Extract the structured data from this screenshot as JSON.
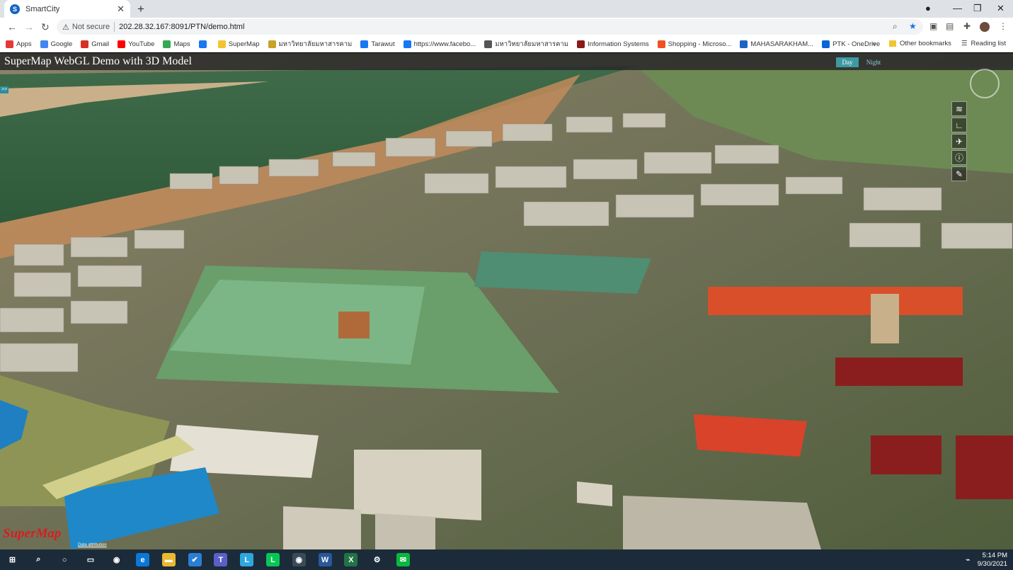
{
  "browser": {
    "tab_title": "SmartCity",
    "tab_close": "✕",
    "new_tab": "+",
    "security_label": "Not secure",
    "url": "202.28.32.167:8091/PTN/demo.html",
    "bookmarks": [
      {
        "label": "Apps",
        "icon": "apps-grid-icon",
        "color": "#e53935"
      },
      {
        "label": "Google",
        "icon": "google-icon",
        "color": "#4285f4"
      },
      {
        "label": "Gmail",
        "icon": "gmail-icon",
        "color": "#d93025"
      },
      {
        "label": "YouTube",
        "icon": "youtube-icon",
        "color": "#ff0000"
      },
      {
        "label": "Maps",
        "icon": "maps-icon",
        "color": "#34a853"
      },
      {
        "label": "",
        "icon": "facebook-icon",
        "color": "#1877f2"
      },
      {
        "label": "SuperMap",
        "icon": "folder-icon",
        "color": "#f4c430"
      },
      {
        "label": "มหาวิทยาลัยมหาสารคาม",
        "icon": "university-icon",
        "color": "#c9a227"
      },
      {
        "label": "Tarawut",
        "icon": "facebook-icon",
        "color": "#1877f2"
      },
      {
        "label": "https://www.facebo...",
        "icon": "facebook-icon",
        "color": "#1877f2"
      },
      {
        "label": "มหาวิทยาลัยมหาสารคาม",
        "icon": "globe-icon",
        "color": "#555555"
      },
      {
        "label": "Information Systems",
        "icon": "emblem-icon",
        "color": "#8b1a1a"
      },
      {
        "label": "Shopping - Microso...",
        "icon": "microsoft-icon",
        "color": "#f25022"
      },
      {
        "label": "MAHASARAKHAM...",
        "icon": "calendar-icon",
        "color": "#1e63c4"
      },
      {
        "label": "PTK - OneDrive",
        "icon": "onedrive-icon",
        "color": "#0a64d8"
      }
    ],
    "more_bookmarks": "»",
    "other_bookmarks": "Other bookmarks",
    "reading_list": "Reading list"
  },
  "app": {
    "title": "SuperMap WebGL Demo with 3D Model",
    "day_label": "Day",
    "night_label": "Night",
    "expander_label": ">>",
    "tools": [
      {
        "name": "layers-icon",
        "glyph": "≋"
      },
      {
        "name": "measure-icon",
        "glyph": "∟"
      },
      {
        "name": "flight-icon",
        "glyph": "✈"
      },
      {
        "name": "info-icon",
        "glyph": "ⓘ"
      },
      {
        "name": "draw-icon",
        "glyph": "✎"
      }
    ],
    "logo_text": "SuperMap",
    "attribution": "Data attribution"
  },
  "taskbar": {
    "apps": [
      {
        "name": "windows-start-icon",
        "glyph": "⊞",
        "color": "#1c2b39"
      },
      {
        "name": "search-icon",
        "glyph": "⌕",
        "color": "#1c2b39"
      },
      {
        "name": "cortana-icon",
        "glyph": "○",
        "color": "#1c2b39"
      },
      {
        "name": "task-view-icon",
        "glyph": "▭",
        "color": "#1c2b39"
      },
      {
        "name": "chrome-icon",
        "glyph": "◉",
        "color": "#1c2b39"
      },
      {
        "name": "edge-icon",
        "glyph": "e",
        "color": "#0b78d7"
      },
      {
        "name": "file-explorer-icon",
        "glyph": "▬",
        "color": "#e9b931"
      },
      {
        "name": "todo-icon",
        "glyph": "✔",
        "color": "#2a7fd4"
      },
      {
        "name": "teams-icon",
        "glyph": "T",
        "color": "#5b5fc7"
      },
      {
        "name": "l-app-icon",
        "glyph": "L",
        "color": "#2ea7e0"
      },
      {
        "name": "line-icon",
        "glyph": "L",
        "color": "#06c755"
      },
      {
        "name": "chrome-active-icon",
        "glyph": "◉",
        "color": "#3b4a59"
      },
      {
        "name": "word-icon",
        "glyph": "W",
        "color": "#2b579a"
      },
      {
        "name": "excel-icon",
        "glyph": "X",
        "color": "#217346"
      },
      {
        "name": "settings-icon",
        "glyph": "⚙",
        "color": "#1c2b39"
      },
      {
        "name": "wechat-icon",
        "glyph": "✉",
        "color": "#09b83e"
      }
    ],
    "time": "5:14 PM",
    "date": "9/30/2021"
  }
}
